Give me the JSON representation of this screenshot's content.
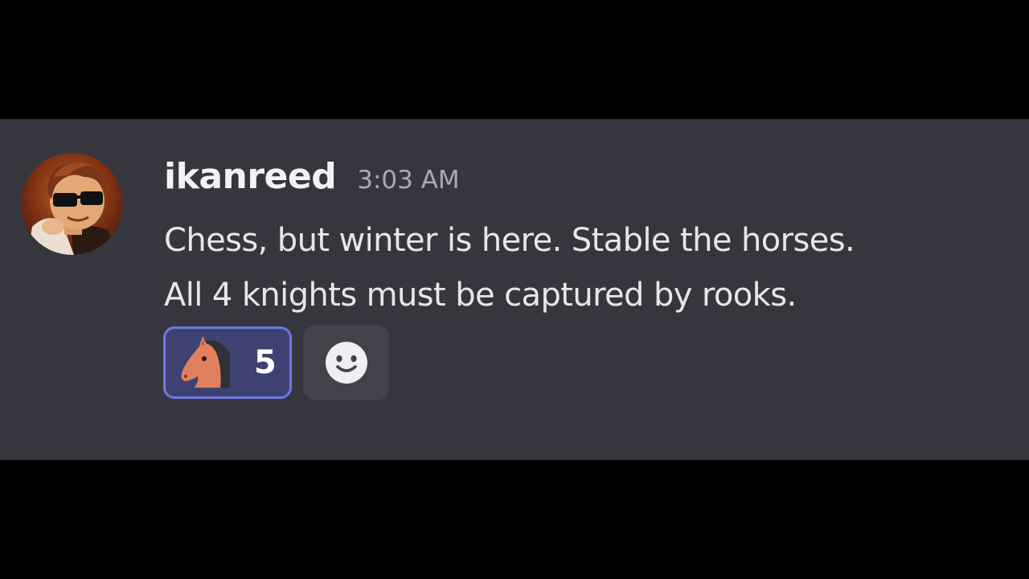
{
  "message": {
    "author": "ikanreed",
    "timestamp": "3:03 AM",
    "lines": [
      "Chess, but winter is here. Stable the horses.",
      "All 4 knights must be captured by rooks."
    ]
  },
  "reactions": [
    {
      "emoji": "horse-face-icon",
      "count": "5",
      "selected": true
    }
  ],
  "add_reaction": {
    "icon": "smiley-face-icon"
  },
  "colors": {
    "panel": "#36363e",
    "reaction_selected_bg": "#3d4270",
    "reaction_selected_border": "#6e79e4",
    "username": "#f2f3f5",
    "timestamp": "#a8a9b2"
  }
}
